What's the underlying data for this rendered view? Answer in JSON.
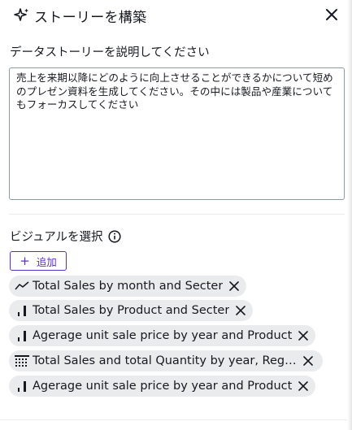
{
  "header": {
    "title": "ストーリーを構築"
  },
  "describe": {
    "label": "データストーリーを説明してください",
    "prompt_value": "売上を来期以降にどのように向上させることができるかについて短めのプレゼン資料を生成してください。その中には製品や産業についてもフォーカスしてください"
  },
  "visuals": {
    "label": "ビジュアルを選択",
    "add_label": "追加",
    "chips": [
      {
        "label": "Total Sales by month and Secter",
        "icon": "line-chart-icon"
      },
      {
        "label": "Total Sales by Product and Secter",
        "icon": "bar-chart-icon"
      },
      {
        "label": "Agerage unit sale price by year and Product",
        "icon": "bar-chart-icon"
      },
      {
        "label": "Total Sales and total Quantity by year, Regi...",
        "icon": "table-icon"
      },
      {
        "label": "Agerage unit sale price by year and Product",
        "icon": "bar-chart-icon"
      }
    ]
  },
  "colors": {
    "accent": "#5a2ecc",
    "chip_bg": "#e9ebed",
    "text": "#16191f",
    "border": "#8d99a8"
  }
}
